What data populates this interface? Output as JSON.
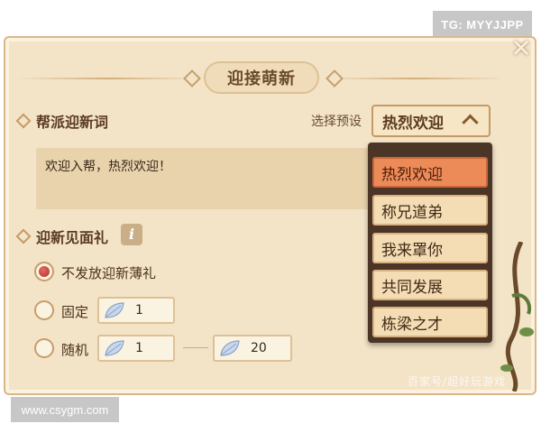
{
  "watermarks": {
    "top_right": "TG: MYYJJPP",
    "bottom_left": "www.csygm.com",
    "source": "百家号/超好玩游戏"
  },
  "window": {
    "title": "迎接萌新",
    "close_glyph": "✕"
  },
  "welcome_words": {
    "section_label": "帮派迎新词",
    "preset_label": "选择预设",
    "preset_selected": "热烈欢迎",
    "text": "欢迎入帮，热烈欢迎！"
  },
  "dropdown": {
    "options": [
      "热烈欢迎",
      "称兄道弟",
      "我来罩你",
      "共同发展",
      "栋梁之才"
    ],
    "active_index": 0
  },
  "gift": {
    "section_label": "迎新见面礼",
    "info_glyph": "i",
    "options": [
      {
        "label": "不发放迎新薄礼",
        "selected": true
      },
      {
        "label": "固定",
        "selected": false,
        "value": "1"
      },
      {
        "label": "随机",
        "selected": false,
        "min": "1",
        "max": "20"
      }
    ]
  },
  "colors": {
    "panel_bg": "#f3e3c7",
    "accent_orange": "#ed8b58",
    "dropdown_frame": "#4a3526",
    "radio_on": "#b62d2b"
  },
  "icons": [
    "close-icon",
    "chevron-up-icon",
    "info-icon",
    "leaf-icon",
    "diamond-bullet-icon"
  ]
}
